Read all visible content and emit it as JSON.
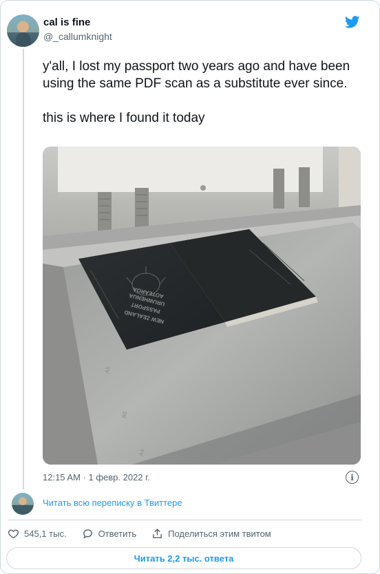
{
  "author": {
    "name": "cal is fine",
    "handle": "@_callumknight"
  },
  "tweet": {
    "text": "y'all, I lost my passport two years ago and have been using the same PDF scan as a substitute ever since.\n\nthis is where I found it today",
    "timestamp": "12:15 AM · 1 февр. 2022 г."
  },
  "photo": {
    "passport_lines": [
      "NEW ZEALAND",
      "PASSPORT",
      "URUWHENUA",
      "AOTEAROA"
    ],
    "scale_marks": [
      "A5",
      "B5",
      "A4"
    ]
  },
  "thread_link": "Читать всю переписку в Твиттере",
  "actions": {
    "likes": "545,1 тыс.",
    "reply": "Ответить",
    "share": "Поделиться этим твитом"
  },
  "read_replies": "Читать 2,2 тыс. ответа",
  "colors": {
    "accent": "#1d9bf0",
    "muted": "#536471",
    "border": "#cfd9de"
  },
  "icons": [
    "twitter-bird-icon",
    "info-icon",
    "heart-icon",
    "reply-icon",
    "share-icon"
  ]
}
